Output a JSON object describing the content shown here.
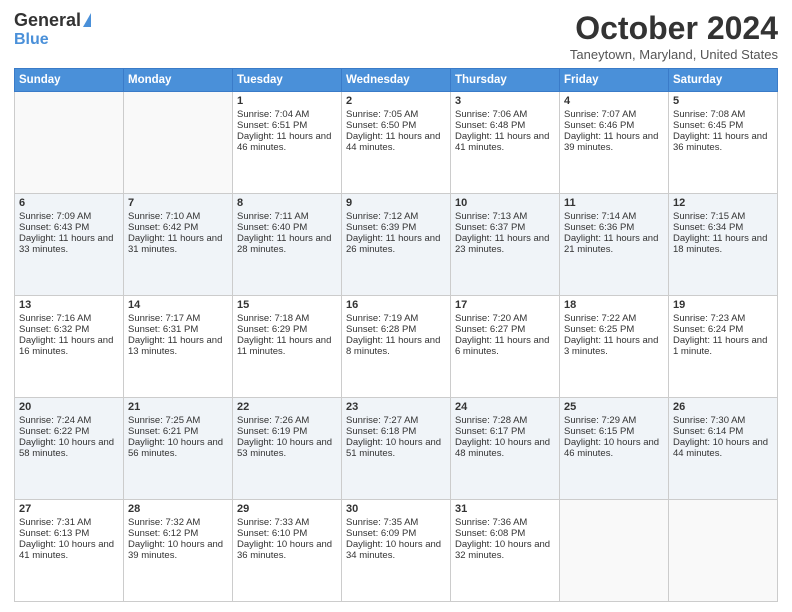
{
  "header": {
    "logo_general": "General",
    "logo_blue": "Blue",
    "month_title": "October 2024",
    "location": "Taneytown, Maryland, United States"
  },
  "weekdays": [
    "Sunday",
    "Monday",
    "Tuesday",
    "Wednesday",
    "Thursday",
    "Friday",
    "Saturday"
  ],
  "weeks": [
    [
      {
        "day": "",
        "sunrise": "",
        "sunset": "",
        "daylight": ""
      },
      {
        "day": "",
        "sunrise": "",
        "sunset": "",
        "daylight": ""
      },
      {
        "day": "1",
        "sunrise": "Sunrise: 7:04 AM",
        "sunset": "Sunset: 6:51 PM",
        "daylight": "Daylight: 11 hours and 46 minutes."
      },
      {
        "day": "2",
        "sunrise": "Sunrise: 7:05 AM",
        "sunset": "Sunset: 6:50 PM",
        "daylight": "Daylight: 11 hours and 44 minutes."
      },
      {
        "day": "3",
        "sunrise": "Sunrise: 7:06 AM",
        "sunset": "Sunset: 6:48 PM",
        "daylight": "Daylight: 11 hours and 41 minutes."
      },
      {
        "day": "4",
        "sunrise": "Sunrise: 7:07 AM",
        "sunset": "Sunset: 6:46 PM",
        "daylight": "Daylight: 11 hours and 39 minutes."
      },
      {
        "day": "5",
        "sunrise": "Sunrise: 7:08 AM",
        "sunset": "Sunset: 6:45 PM",
        "daylight": "Daylight: 11 hours and 36 minutes."
      }
    ],
    [
      {
        "day": "6",
        "sunrise": "Sunrise: 7:09 AM",
        "sunset": "Sunset: 6:43 PM",
        "daylight": "Daylight: 11 hours and 33 minutes."
      },
      {
        "day": "7",
        "sunrise": "Sunrise: 7:10 AM",
        "sunset": "Sunset: 6:42 PM",
        "daylight": "Daylight: 11 hours and 31 minutes."
      },
      {
        "day": "8",
        "sunrise": "Sunrise: 7:11 AM",
        "sunset": "Sunset: 6:40 PM",
        "daylight": "Daylight: 11 hours and 28 minutes."
      },
      {
        "day": "9",
        "sunrise": "Sunrise: 7:12 AM",
        "sunset": "Sunset: 6:39 PM",
        "daylight": "Daylight: 11 hours and 26 minutes."
      },
      {
        "day": "10",
        "sunrise": "Sunrise: 7:13 AM",
        "sunset": "Sunset: 6:37 PM",
        "daylight": "Daylight: 11 hours and 23 minutes."
      },
      {
        "day": "11",
        "sunrise": "Sunrise: 7:14 AM",
        "sunset": "Sunset: 6:36 PM",
        "daylight": "Daylight: 11 hours and 21 minutes."
      },
      {
        "day": "12",
        "sunrise": "Sunrise: 7:15 AM",
        "sunset": "Sunset: 6:34 PM",
        "daylight": "Daylight: 11 hours and 18 minutes."
      }
    ],
    [
      {
        "day": "13",
        "sunrise": "Sunrise: 7:16 AM",
        "sunset": "Sunset: 6:32 PM",
        "daylight": "Daylight: 11 hours and 16 minutes."
      },
      {
        "day": "14",
        "sunrise": "Sunrise: 7:17 AM",
        "sunset": "Sunset: 6:31 PM",
        "daylight": "Daylight: 11 hours and 13 minutes."
      },
      {
        "day": "15",
        "sunrise": "Sunrise: 7:18 AM",
        "sunset": "Sunset: 6:29 PM",
        "daylight": "Daylight: 11 hours and 11 minutes."
      },
      {
        "day": "16",
        "sunrise": "Sunrise: 7:19 AM",
        "sunset": "Sunset: 6:28 PM",
        "daylight": "Daylight: 11 hours and 8 minutes."
      },
      {
        "day": "17",
        "sunrise": "Sunrise: 7:20 AM",
        "sunset": "Sunset: 6:27 PM",
        "daylight": "Daylight: 11 hours and 6 minutes."
      },
      {
        "day": "18",
        "sunrise": "Sunrise: 7:22 AM",
        "sunset": "Sunset: 6:25 PM",
        "daylight": "Daylight: 11 hours and 3 minutes."
      },
      {
        "day": "19",
        "sunrise": "Sunrise: 7:23 AM",
        "sunset": "Sunset: 6:24 PM",
        "daylight": "Daylight: 11 hours and 1 minute."
      }
    ],
    [
      {
        "day": "20",
        "sunrise": "Sunrise: 7:24 AM",
        "sunset": "Sunset: 6:22 PM",
        "daylight": "Daylight: 10 hours and 58 minutes."
      },
      {
        "day": "21",
        "sunrise": "Sunrise: 7:25 AM",
        "sunset": "Sunset: 6:21 PM",
        "daylight": "Daylight: 10 hours and 56 minutes."
      },
      {
        "day": "22",
        "sunrise": "Sunrise: 7:26 AM",
        "sunset": "Sunset: 6:19 PM",
        "daylight": "Daylight: 10 hours and 53 minutes."
      },
      {
        "day": "23",
        "sunrise": "Sunrise: 7:27 AM",
        "sunset": "Sunset: 6:18 PM",
        "daylight": "Daylight: 10 hours and 51 minutes."
      },
      {
        "day": "24",
        "sunrise": "Sunrise: 7:28 AM",
        "sunset": "Sunset: 6:17 PM",
        "daylight": "Daylight: 10 hours and 48 minutes."
      },
      {
        "day": "25",
        "sunrise": "Sunrise: 7:29 AM",
        "sunset": "Sunset: 6:15 PM",
        "daylight": "Daylight: 10 hours and 46 minutes."
      },
      {
        "day": "26",
        "sunrise": "Sunrise: 7:30 AM",
        "sunset": "Sunset: 6:14 PM",
        "daylight": "Daylight: 10 hours and 44 minutes."
      }
    ],
    [
      {
        "day": "27",
        "sunrise": "Sunrise: 7:31 AM",
        "sunset": "Sunset: 6:13 PM",
        "daylight": "Daylight: 10 hours and 41 minutes."
      },
      {
        "day": "28",
        "sunrise": "Sunrise: 7:32 AM",
        "sunset": "Sunset: 6:12 PM",
        "daylight": "Daylight: 10 hours and 39 minutes."
      },
      {
        "day": "29",
        "sunrise": "Sunrise: 7:33 AM",
        "sunset": "Sunset: 6:10 PM",
        "daylight": "Daylight: 10 hours and 36 minutes."
      },
      {
        "day": "30",
        "sunrise": "Sunrise: 7:35 AM",
        "sunset": "Sunset: 6:09 PM",
        "daylight": "Daylight: 10 hours and 34 minutes."
      },
      {
        "day": "31",
        "sunrise": "Sunrise: 7:36 AM",
        "sunset": "Sunset: 6:08 PM",
        "daylight": "Daylight: 10 hours and 32 minutes."
      },
      {
        "day": "",
        "sunrise": "",
        "sunset": "",
        "daylight": ""
      },
      {
        "day": "",
        "sunrise": "",
        "sunset": "",
        "daylight": ""
      }
    ]
  ]
}
